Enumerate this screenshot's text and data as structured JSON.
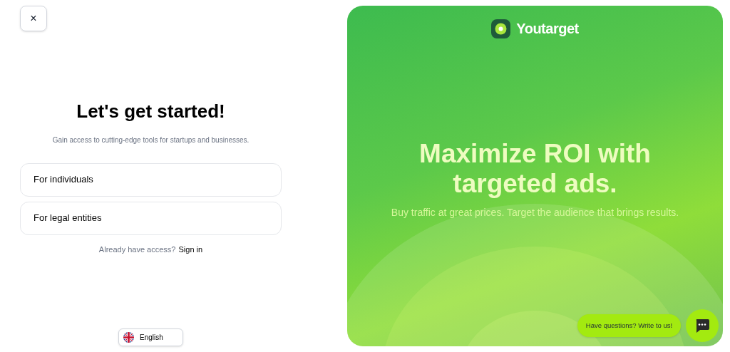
{
  "close_button": {
    "label": "×"
  },
  "heading": "Let's get started!",
  "subtitle": "Gain access to cutting-edge tools for startups and businesses.",
  "options": [
    {
      "label": "For individuals"
    },
    {
      "label": "For legal entities"
    }
  ],
  "sign_in": {
    "prompt": "Already have access?",
    "link": "Sign in"
  },
  "language": {
    "label": "English"
  },
  "promo": {
    "brand": "Youtarget",
    "headline": "Maximize ROI with targeted ads.",
    "tagline": "Buy traffic at great prices. Target the audience that brings results."
  },
  "chat": {
    "prompt": "Have questions? Write to us!"
  }
}
